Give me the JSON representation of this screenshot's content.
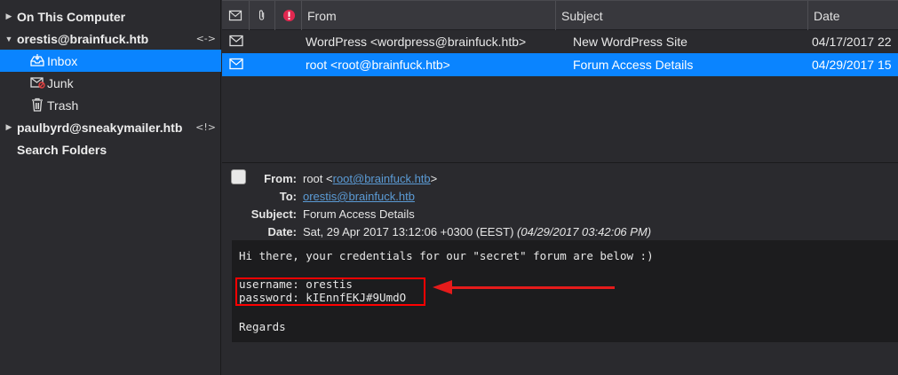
{
  "sidebar": {
    "items": [
      {
        "label": "On This Computer",
        "indicator": ""
      },
      {
        "label": "orestis@brainfuck.htb",
        "indicator": "<->"
      },
      {
        "label": "Inbox"
      },
      {
        "label": "Junk"
      },
      {
        "label": "Trash"
      },
      {
        "label": "paulbyrd@sneakymailer.htb",
        "indicator": "<!>"
      },
      {
        "label": "Search Folders"
      }
    ]
  },
  "message_list": {
    "columns": {
      "from": "From",
      "subject": "Subject",
      "date": "Date"
    },
    "rows": [
      {
        "from": "WordPress <wordpress@brainfuck.htb>",
        "subject": "New WordPress Site",
        "date": "04/17/2017 22"
      },
      {
        "from": "root <root@brainfuck.htb>",
        "subject": "Forum Access Details",
        "date": "04/29/2017 15"
      }
    ]
  },
  "preview": {
    "labels": {
      "from": "From:",
      "to": "To:",
      "subject": "Subject:",
      "date": "Date:"
    },
    "from_name": "root <",
    "from_email": "root@brainfuck.htb",
    "from_close": ">",
    "to": "orestis@brainfuck.htb",
    "subject": "Forum Access Details",
    "date": "Sat, 29 Apr 2017 13:12:06 +0300 (EEST)",
    "date_local": "(04/29/2017 03:42:06 PM)",
    "body": {
      "line1": "Hi there, your credentials for our \"secret\" forum are below :)",
      "username": "username: orestis",
      "password": "password: kIEnnfEKJ#9UmdO",
      "regards": "Regards"
    }
  },
  "colors": {
    "accent": "#0a84ff",
    "annotation": "#e51b1b"
  }
}
